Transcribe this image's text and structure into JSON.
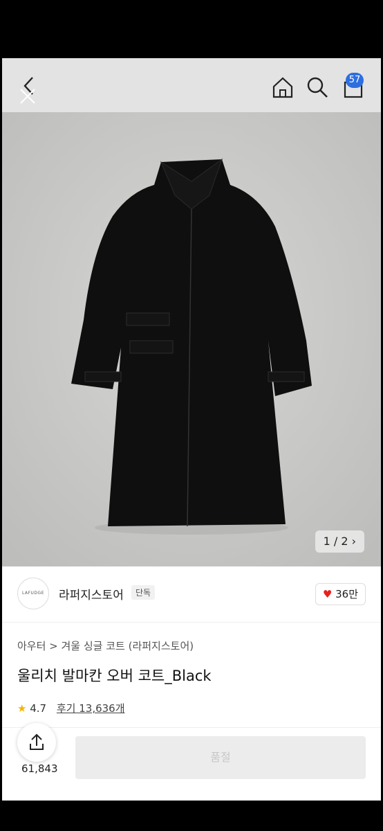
{
  "header": {
    "cart_badge": "57"
  },
  "gallery": {
    "pager": "1 / 2 ›"
  },
  "store": {
    "logo_text": "LAFUDGE",
    "name": "라퍼지스토어",
    "exclusive": "단독",
    "likes": "36만"
  },
  "breadcrumb": "아우터 > 겨울 싱글 코트 (라퍼지스토어)",
  "product": {
    "title": "울리치 발마칸 오버 코트_Black",
    "rating": "4.7",
    "reviews": "후기 13,636개"
  },
  "bottom": {
    "like_count": "61,843",
    "status_button": "품절"
  },
  "colors": {
    "accent": "#2d6fe0",
    "heart": "#e8201c"
  }
}
